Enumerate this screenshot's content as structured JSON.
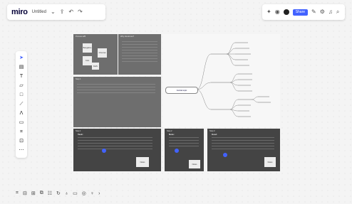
{
  "app": {
    "logo": "miro",
    "board_title": "Untitled"
  },
  "topbar": {
    "share_label": "Share"
  },
  "left_toolbar": {
    "tools": [
      "select-icon",
      "frame-icon",
      "text-icon",
      "sticky-note-icon",
      "shape-icon",
      "pen-icon",
      "connector-icon",
      "comment-icon",
      "template-icon",
      "upload-icon",
      "more-icon"
    ]
  },
  "bottom_toolbar": {
    "tools": [
      "frames-icon",
      "board-icon",
      "chat-icon",
      "cards-icon",
      "kanban-icon",
      "mindmap-icon",
      "timer-icon",
      "video-icon",
      "screen-icon",
      "vote-icon",
      "more-icon"
    ]
  },
  "frames": {
    "top_left": {
      "title": "Process A/B",
      "stickies": [
        "Bangalore",
        "Chennai",
        "Cost",
        "Delhi"
      ]
    },
    "top_middle": {
      "title": "Why should we?"
    },
    "mid_wide": {
      "title": "Step 1"
    },
    "mindmap": {
      "center": "Central topic"
    },
    "step1": {
      "title": "Step 1",
      "heading": "Task:",
      "sticky": "Notes"
    },
    "step2": {
      "title": "Step 2",
      "heading": "Note:",
      "sticky": "Notes"
    },
    "step3": {
      "title": "Step 3",
      "heading": "Goal:",
      "sticky": "Notes"
    }
  }
}
